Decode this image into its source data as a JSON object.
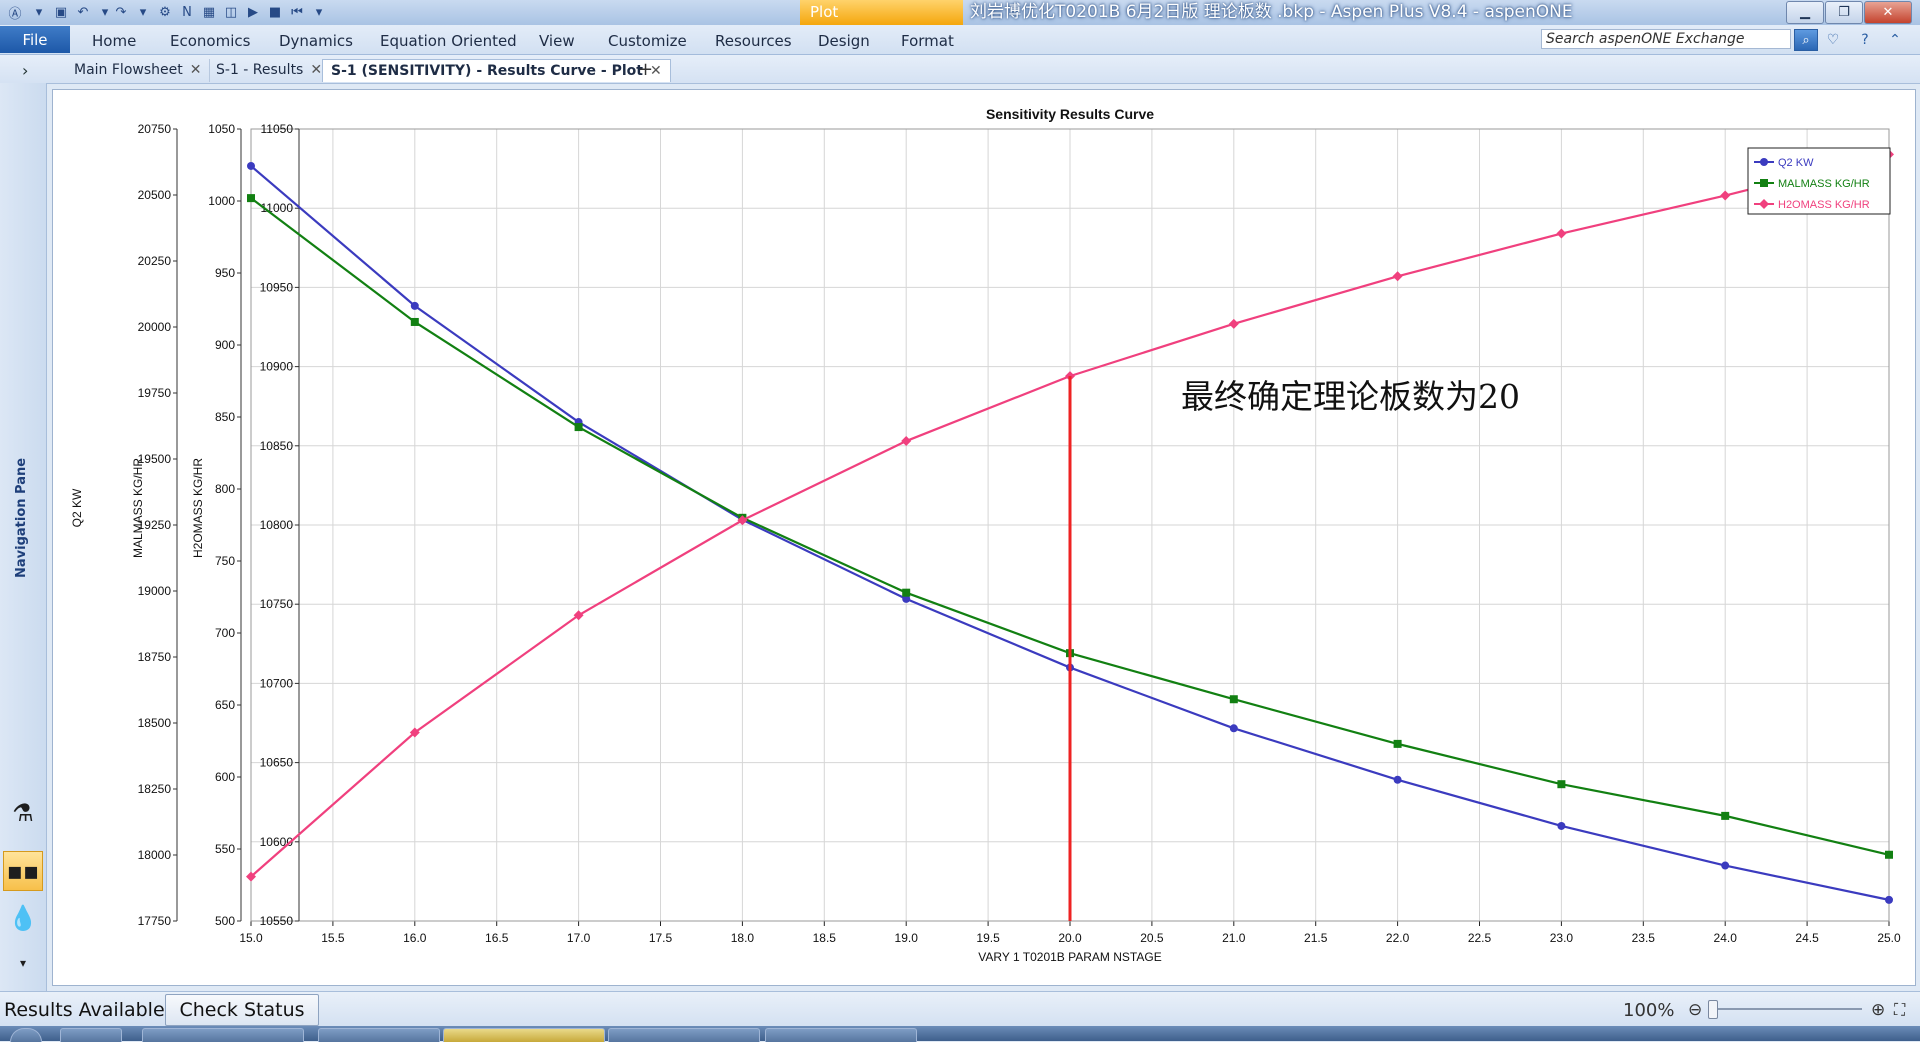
{
  "titlebar": {
    "context_tab": "Plot",
    "window_title": "刘岩博优化T0201B  6月2日版 理论板数 .bkp - Aspen Plus V8.4 - aspenONE"
  },
  "ribbon": {
    "file": "File",
    "tabs": [
      "Home",
      "Economics",
      "Dynamics",
      "Equation Oriented",
      "View",
      "Customize",
      "Resources",
      "Design",
      "Format"
    ],
    "search_placeholder": "Search aspenONE Exchange"
  },
  "doc_tabs": [
    {
      "label": "Main Flowsheet",
      "active": false
    },
    {
      "label": "S-1 - Results",
      "active": false
    },
    {
      "label": "S-1 (SENSITIVITY) - Results Curve - Plot",
      "active": true
    }
  ],
  "nav_pane": {
    "label": "Navigation Pane"
  },
  "chart_data": {
    "type": "line",
    "title": "Sensitivity Results Curve",
    "xlabel": "VARY    1  T0201B PARAM NSTAGE",
    "xlim": [
      15.0,
      25.0
    ],
    "xticks": [
      "15.0",
      "15.5",
      "16.0",
      "16.5",
      "17.0",
      "17.5",
      "18.0",
      "18.5",
      "19.0",
      "19.5",
      "20.0",
      "20.5",
      "21.0",
      "21.5",
      "22.0",
      "22.5",
      "23.0",
      "23.5",
      "24.0",
      "24.5",
      "25.0"
    ],
    "x": [
      15,
      16,
      17,
      18,
      19,
      20,
      21,
      22,
      23,
      24,
      25
    ],
    "axes": [
      {
        "label": "Q2 KW",
        "ylim": [
          17750,
          20750
        ],
        "ticks": [
          "20750",
          "20500",
          "20250",
          "20000",
          "19750",
          "19500",
          "19250",
          "19000",
          "18750",
          "18500",
          "18250",
          "18000",
          "17750"
        ]
      },
      {
        "label": "MALMASS KG/HR",
        "ylim": [
          500,
          1050
        ],
        "ticks": [
          "1050",
          "1000",
          "950",
          "900",
          "850",
          "800",
          "750",
          "700",
          "650",
          "600",
          "550",
          "500"
        ]
      },
      {
        "label": "H2OMASS KG/HR",
        "ylim": [
          10550,
          11050
        ],
        "ticks": [
          "11050",
          "11000",
          "10950",
          "10900",
          "10850",
          "10800",
          "10750",
          "10700",
          "10650",
          "10600",
          "10550"
        ]
      }
    ],
    "series": [
      {
        "name": "Q2 KW",
        "axis": 0,
        "color": "#3b3bbf",
        "marker": "circle",
        "values": [
          20610,
          20080,
          19640,
          19270,
          18970,
          18710,
          18480,
          18285,
          18110,
          17960,
          17830
        ]
      },
      {
        "name": "MALMASS KG/HR",
        "axis": 1,
        "color": "#128012",
        "marker": "square",
        "values": [
          1002,
          916,
          843,
          780,
          728,
          686,
          654,
          623,
          595,
          573,
          546
        ]
      },
      {
        "name": "H2OMASS KG/HR",
        "axis": 2,
        "color": "#f0407e",
        "marker": "diamond",
        "values": [
          10578,
          10669,
          10743,
          10803,
          10853,
          10894,
          10927,
          10957,
          10984,
          11008,
          11034
        ]
      }
    ],
    "marker_line": {
      "x": 20.0,
      "color": "#ee2222"
    },
    "annotation": "最终确定理论板数为20",
    "legend_position": "top-right",
    "grid": true
  },
  "statusbar": {
    "status": "Results Available",
    "check_status": "Check Status",
    "zoom": "100%"
  },
  "colors": {
    "accent": "#1d58a8",
    "context": "#f4a60d"
  }
}
